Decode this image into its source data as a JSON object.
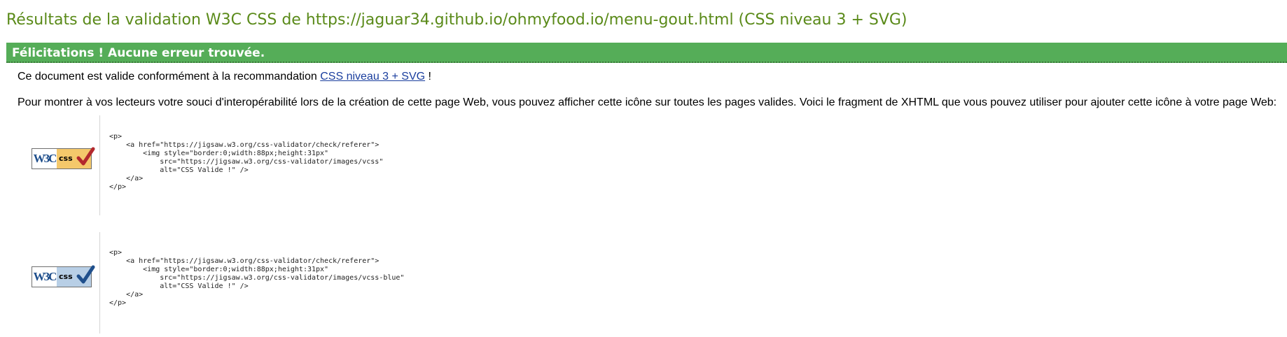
{
  "colors": {
    "title": "#5a8a19",
    "banner_bg": "#55ad58",
    "banner_text": "#ffffff",
    "link": "#1a3e9e"
  },
  "title": "Résultats de la validation W3C CSS de https://jaguar34.github.io/ohmyfood.io/menu-gout.html (CSS niveau 3 + SVG)",
  "banner": "Félicitations ! Aucune erreur trouvée.",
  "valid_text": {
    "before": "Ce document est valide conformément à la recommandation ",
    "link": "CSS niveau 3 + SVG",
    "after": " !"
  },
  "info_text": "Pour montrer à vos lecteurs votre souci d'interopérabilité lors de la création de cette page Web, vous pouvez afficher cette icône sur toutes les pages valides. Voici le fragment de XHTML que vous pouvez utiliser pour ajouter cette icône à votre page Web:",
  "badges": [
    {
      "w3c": "W3C",
      "css": "css",
      "icon": "w3c-css-gold-checkmark-icon",
      "color": "#f4c86b",
      "check_color": "#b3282d",
      "code": "<p>\n    <a href=\"https://jigsaw.w3.org/css-validator/check/referer\">\n        <img style=\"border:0;width:88px;height:31px\"\n            src=\"https://jigsaw.w3.org/css-validator/images/vcss\"\n            alt=\"CSS Valide !\" />\n    </a>\n</p>"
    },
    {
      "w3c": "W3C",
      "css": "css",
      "icon": "w3c-css-blue-checkmark-icon",
      "color": "#b8cfe6",
      "check_color": "#1f4f8c",
      "code": "<p>\n    <a href=\"https://jigsaw.w3.org/css-validator/check/referer\">\n        <img style=\"border:0;width:88px;height:31px\"\n            src=\"https://jigsaw.w3.org/css-validator/images/vcss-blue\"\n            alt=\"CSS Valide !\" />\n    </a>\n</p>"
    }
  ]
}
